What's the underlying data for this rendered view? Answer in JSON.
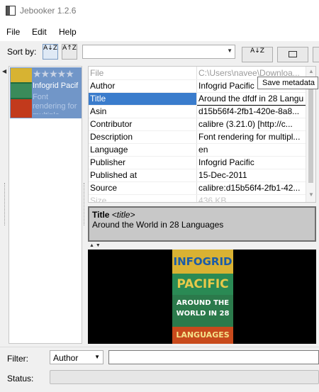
{
  "window": {
    "title": "Jebooker 1.2.6"
  },
  "menu": {
    "file": "File",
    "edit": "Edit",
    "help": "Help"
  },
  "toolbar": {
    "sort_by_label": "Sort by:",
    "sort_asc_icon": "A↓Z",
    "sort_desc_icon": "A↑Z",
    "sort_field_value": "",
    "sort_order_icon": "A↓Z"
  },
  "book_list": {
    "items": [
      {
        "stars": "★★★★★",
        "author": "Infogrid Pacif",
        "description": "Font rendering for multiple"
      }
    ]
  },
  "metadata_table": {
    "rows": [
      {
        "key": "File",
        "value": "C:\\Users\\navee\\Downloa..."
      },
      {
        "key": "Author",
        "value": "Infogrid Pacific"
      },
      {
        "key": "Title",
        "value": "Around the dfdf in 28 Langu"
      },
      {
        "key": "Asin",
        "value": "d15b56f4-2fb1-420e-8a8..."
      },
      {
        "key": "Contributor",
        "value": "calibre (3.21.0) [http://c..."
      },
      {
        "key": "Description",
        "value": "Font rendering for multipl..."
      },
      {
        "key": "Language",
        "value": "en"
      },
      {
        "key": "Publisher",
        "value": "Infogrid Pacific"
      },
      {
        "key": "Published at",
        "value": "15-Dec-2011"
      },
      {
        "key": "Source",
        "value": "calibre:d15b56f4-2fb1-42..."
      },
      {
        "key": "Size",
        "value": "436 KB"
      }
    ]
  },
  "tooltip": {
    "text": "Save metadata"
  },
  "detail": {
    "label": "Title",
    "tag": "<title>",
    "value": "Around the World in 28 Languages"
  },
  "cover": {
    "line1": "INFOGRID",
    "line2": "PACIFIC",
    "line3a": "AROUND THE",
    "line3b": "WORLD IN 28",
    "line4": "LANGUAGES"
  },
  "filter": {
    "label": "Filter:",
    "field": "Author",
    "query": ""
  },
  "status": {
    "label": "Status:",
    "text": ""
  }
}
